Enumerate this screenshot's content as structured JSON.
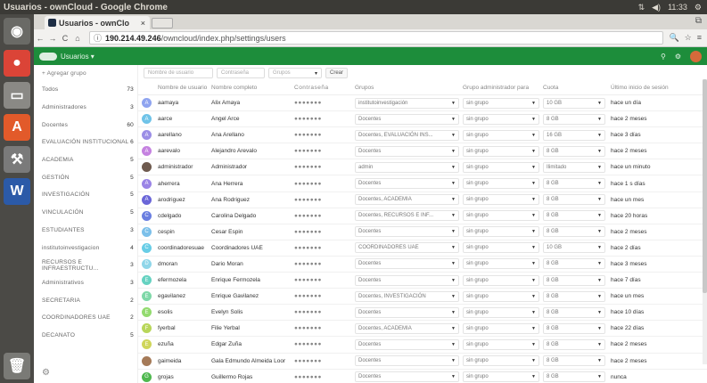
{
  "os": {
    "title": "Usuarios - ownCloud - Google Chrome",
    "clock": "11:33"
  },
  "browser": {
    "tab_title": "Usuarios - ownClo",
    "tab_close": "×",
    "url_host": "190.214.49.246",
    "url_path": "/owncloud/index.php/settings/users"
  },
  "header": {
    "app_name": "Usuarios ▾"
  },
  "sidebar": {
    "add_group": "+ Agregar grupo",
    "groups": [
      {
        "label": "Todos",
        "count": "73"
      },
      {
        "label": "Administradores",
        "count": "3"
      },
      {
        "label": "Docentes",
        "count": "60"
      },
      {
        "label": "EVALUACIÓN INSTITUCIONAL",
        "count": "6"
      },
      {
        "label": "ACADEMIA",
        "count": "5"
      },
      {
        "label": "GESTIÓN",
        "count": "5"
      },
      {
        "label": "INVESTIGACIÓN",
        "count": "5"
      },
      {
        "label": "VINCULACIÓN",
        "count": "5"
      },
      {
        "label": "ESTUDIANTES",
        "count": "3"
      },
      {
        "label": "institutoinvestigacion",
        "count": "4"
      },
      {
        "label": "RECURSOS E INFRAESTRUCTU...",
        "count": "3"
      },
      {
        "label": "Administrativos",
        "count": "3"
      },
      {
        "label": "SECRETARIA",
        "count": "2"
      },
      {
        "label": "COORDINADORES UAE",
        "count": "2"
      },
      {
        "label": "DECANATO",
        "count": "5"
      }
    ]
  },
  "new_user": {
    "username_placeholder": "Nombre de usuario",
    "password_placeholder": "Contraseña",
    "groups_label": "Grupos",
    "create_label": "Crear"
  },
  "columns": {
    "username": "Nombre de usuario",
    "fullname": "Nombre completo",
    "password": "Contraseña",
    "groups": "Grupos",
    "subadmin": "Grupo administrador para",
    "quota": "Cuota",
    "last_login": "Último inicio de sesión"
  },
  "users": [
    {
      "initial": "A",
      "color": "#8fa4f0",
      "user": "aamaya",
      "name": "Alix Amaya",
      "pass": "●●●●●●●",
      "groups": "institutoinvestigación",
      "sub": "sin grupo",
      "quota": "10 GB",
      "last": "hace un día"
    },
    {
      "initial": "A",
      "color": "#6fc3e8",
      "user": "aarce",
      "name": "Angel Arce",
      "pass": "●●●●●●●",
      "groups": "Docentes",
      "sub": "sin grupo",
      "quota": "8 GB",
      "last": "hace 2 meses"
    },
    {
      "initial": "A",
      "color": "#9b8ee6",
      "user": "aarellano",
      "name": "Ana Arellano",
      "pass": "●●●●●●●",
      "groups": "Docentes, EVALUACIÓN INS...",
      "sub": "sin grupo",
      "quota": "16 GB",
      "last": "hace 3 días"
    },
    {
      "initial": "A",
      "color": "#c582e0",
      "user": "aarevalo",
      "name": "Alejandro Arevalo",
      "pass": "●●●●●●●",
      "groups": "Docentes",
      "sub": "sin grupo",
      "quota": "8 GB",
      "last": "hace 2 meses"
    },
    {
      "initial": "",
      "color": "#6e5a4e",
      "user": "administrador",
      "name": "Administrador",
      "pass": "●●●●●●●",
      "groups": "admin",
      "sub": "sin grupo",
      "quota": "Ilimitado",
      "last": "hace un minuto"
    },
    {
      "initial": "A",
      "color": "#9a84e6",
      "user": "aherrera",
      "name": "Ana Herrera",
      "pass": "●●●●●●●",
      "groups": "Docentes",
      "sub": "sin grupo",
      "quota": "8 GB",
      "last": "hace 1 s días"
    },
    {
      "initial": "A",
      "color": "#6a66d8",
      "user": "arodriguez",
      "name": "Ana Rodriguez",
      "pass": "●●●●●●●",
      "groups": "Docentes, ACADEMIA",
      "sub": "sin grupo",
      "quota": "8 GB",
      "last": "hace un mes"
    },
    {
      "initial": "C",
      "color": "#6a7ee0",
      "user": "cdelgado",
      "name": "Carolina Delgado",
      "pass": "●●●●●●●",
      "groups": "Docentes, RECURSOS E INF...",
      "sub": "sin grupo",
      "quota": "8 GB",
      "last": "hace 20 horas"
    },
    {
      "initial": "C",
      "color": "#7cc0ea",
      "user": "cespin",
      "name": "Cesar Espin",
      "pass": "●●●●●●●",
      "groups": "Docentes",
      "sub": "sin grupo",
      "quota": "8 GB",
      "last": "hace 2 meses"
    },
    {
      "initial": "C",
      "color": "#68cde6",
      "user": "coordinadoresuae",
      "name": "Coordinadores UAE",
      "pass": "●●●●●●●",
      "groups": "COORDINADORES UAE",
      "sub": "sin grupo",
      "quota": "10 GB",
      "last": "hace 2 días"
    },
    {
      "initial": "D",
      "color": "#8fd6e9",
      "user": "dmoran",
      "name": "Dario Moran",
      "pass": "●●●●●●●",
      "groups": "Docentes",
      "sub": "sin grupo",
      "quota": "8 GB",
      "last": "hace 3 meses"
    },
    {
      "initial": "E",
      "color": "#66d2c1",
      "user": "efermozela",
      "name": "Enrique Fermozela",
      "pass": "●●●●●●●",
      "groups": "Docentes",
      "sub": "sin grupo",
      "quota": "8 GB",
      "last": "hace 7 días"
    },
    {
      "initial": "E",
      "color": "#7fd8a8",
      "user": "egavilanez",
      "name": "Enrique Gavilanez",
      "pass": "●●●●●●●",
      "groups": "Docentes, INVESTIGACIÓN",
      "sub": "sin grupo",
      "quota": "8 GB",
      "last": "hace un mes"
    },
    {
      "initial": "E",
      "color": "#93db6f",
      "user": "esolis",
      "name": "Evelyn Solis",
      "pass": "●●●●●●●",
      "groups": "Docentes",
      "sub": "sin grupo",
      "quota": "8 GB",
      "last": "hace 10 días"
    },
    {
      "initial": "F",
      "color": "#b8d65a",
      "user": "fyerbal",
      "name": "Filie Yerbal",
      "pass": "●●●●●●●",
      "groups": "Docentes, ACADEMIA",
      "sub": "sin grupo",
      "quota": "8 GB",
      "last": "hace 22 días"
    },
    {
      "initial": "E",
      "color": "#cfd65a",
      "user": "ezuña",
      "name": "Edgar Zuña",
      "pass": "●●●●●●●",
      "groups": "Docentes",
      "sub": "sin grupo",
      "quota": "8 GB",
      "last": "hace 2 meses"
    },
    {
      "initial": "",
      "color": "#a57a58",
      "user": "gaimeida",
      "name": "Gala Edmundo Almeida Loor",
      "pass": "●●●●●●●",
      "groups": "Docentes",
      "sub": "sin grupo",
      "quota": "8 GB",
      "last": "hace 2 meses"
    },
    {
      "initial": "G",
      "color": "#4fb84f",
      "user": "grojas",
      "name": "Guillermo Rojas",
      "pass": "●●●●●●●",
      "groups": "Docentes",
      "sub": "sin grupo",
      "quota": "8 GB",
      "last": "nunca"
    }
  ]
}
